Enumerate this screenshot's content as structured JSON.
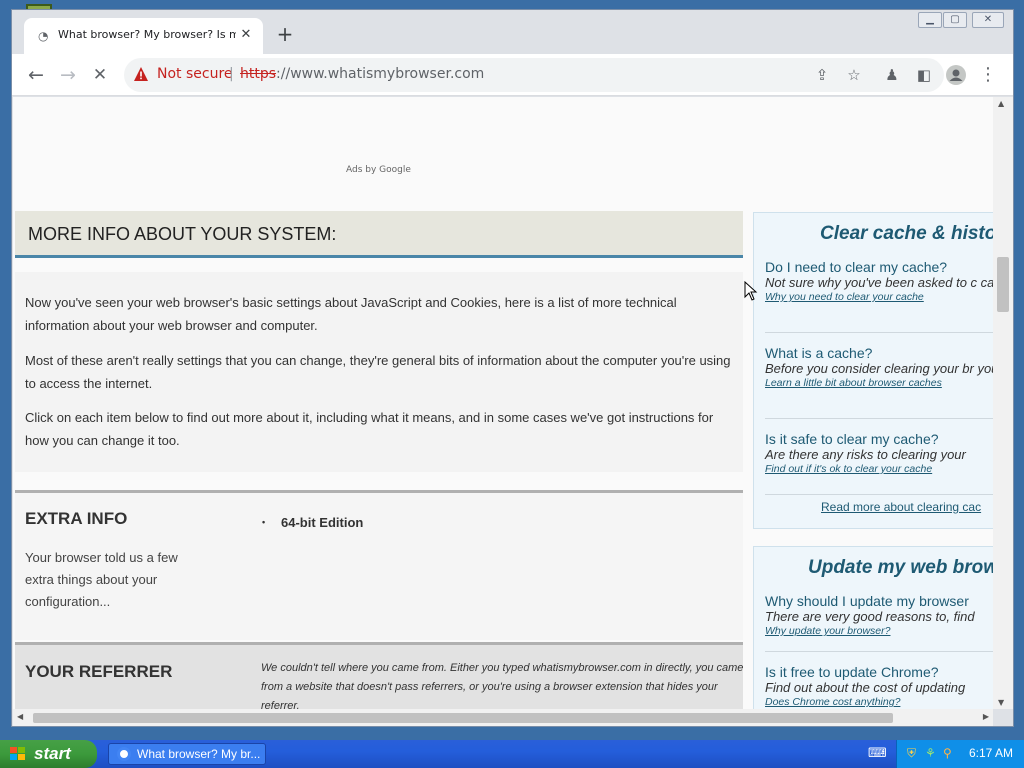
{
  "browser": {
    "tab_title": "What browser? My browser? Is my b",
    "new_tab_label": "+",
    "tab_close_label": "✕",
    "security_label": "Not secure",
    "url_scheme": "https",
    "url_rest": "://www.whatismybrowser.com"
  },
  "page": {
    "ads_label": "Ads by Google",
    "more_info": {
      "heading": "MORE INFO ABOUT YOUR SYSTEM:",
      "paragraphs": [
        "Now you've seen your web browser's basic settings about JavaScript and Cookies, here is a list of more technical information about your web browser and computer.",
        "Most of these aren't really settings that you can change, they're general bits of information about the computer you're using to access the internet.",
        "Click on each item below to find out more about it, including what it means, and in some cases we've got instructions for how you can change it too."
      ]
    },
    "extra_info": {
      "title": "EXTRA INFO",
      "description": "Your browser told us a few extra things about your configuration...",
      "items": [
        "64-bit Edition"
      ]
    },
    "referrer": {
      "title": "YOUR REFERRER",
      "text": "We couldn't tell where you came from. Either you typed whatismybrowser.com in directly, you came from a website that doesn't pass referrers, or you're using a browser extension that hides your referrer."
    }
  },
  "sidebar": {
    "cache_card": {
      "title": "Clear cache & histo",
      "items": [
        {
          "q": "Do I need to clear my cache?",
          "a": "Not sure why you've been asked to c cache? We can explain.",
          "link": "Why you need to clear your cache"
        },
        {
          "q": "What is a cache?",
          "a": "Before you consider clearing your br you should know what it is!",
          "link": "Learn a little bit about browser caches"
        },
        {
          "q": "Is it safe to clear my cache?",
          "a": "Are there any risks to clearing your",
          "link": "Find out if it's ok to clear your cache"
        }
      ],
      "more": "Read more about clearing cac"
    },
    "update_card": {
      "title": "Update my web brow",
      "items": [
        {
          "q": "Why should I update my browser",
          "a": "There are very good reasons to, find",
          "link": "Why update your browser?"
        },
        {
          "q": "Is it free to update Chrome?",
          "a": "Find out about the cost of updating",
          "link": "Does Chrome cost anything?"
        }
      ]
    }
  },
  "taskbar": {
    "start_label": "start",
    "task_label": "What browser? My br...",
    "clock": "6:17 AM"
  },
  "icons": {
    "back": "arrow-left",
    "forward": "arrow-right",
    "reload": "close-stop",
    "warning": "warning-triangle",
    "share": "share",
    "bookmark": "star",
    "extensions": "puzzle",
    "side_panel": "side-panel",
    "profile": "avatar",
    "menu": "kebab-menu"
  },
  "colors": {
    "accent_blue": "#1e5a73",
    "not_secure_red": "#c5221f",
    "header_underline": "#4a86a8"
  }
}
